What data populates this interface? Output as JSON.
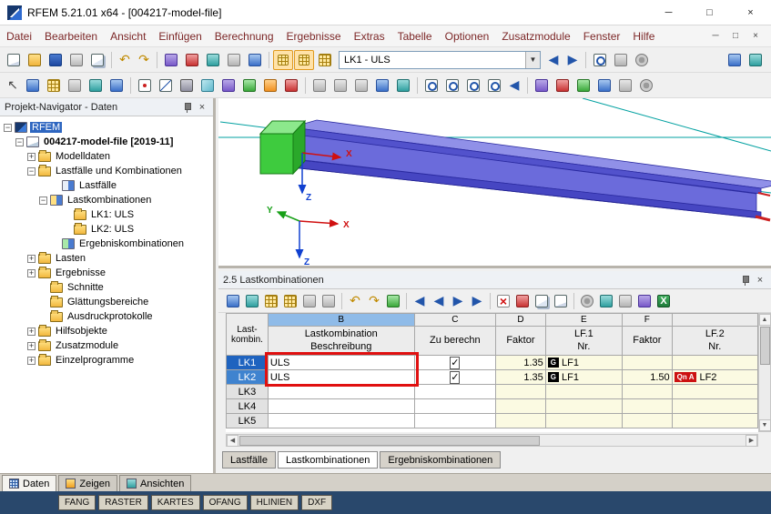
{
  "window": {
    "title": "RFEM 5.21.01 x64 - [004217-model-file]"
  },
  "glyphs": {
    "minimize": "─",
    "maximize": "□",
    "close": "×",
    "dropdown": "▼",
    "undo": "↶",
    "redo": "↷",
    "prev": "◀",
    "next": "▶",
    "check": "✓",
    "plus": "+",
    "minus": "−",
    "up": "▲",
    "down": "▼",
    "left": "◀",
    "right": "▶"
  },
  "menu": {
    "items": [
      "Datei",
      "Bearbeiten",
      "Ansicht",
      "Einfügen",
      "Berechnung",
      "Ergebnisse",
      "Extras",
      "Tabelle",
      "Optionen",
      "Zusatzmodule",
      "Fenster",
      "Hilfe"
    ]
  },
  "toolbar_main": {
    "loadcase_combo": {
      "value": "LK1 - ULS"
    },
    "icon_names": [
      "new-file",
      "open-file",
      "save-file",
      "print",
      "copy",
      "undo",
      "redo",
      "render-mode",
      "show-loads",
      "show-supports",
      "page-setup",
      "link-model",
      "show-tables",
      "show-grid",
      "table-numbers",
      "previous-loadcase",
      "next-loadcase",
      "search",
      "display-factors",
      "settings",
      "panel-toggle",
      "help"
    ]
  },
  "toolbar_secondary": {
    "icon_names": [
      "select",
      "snap",
      "grid-settings",
      "ortho-mode",
      "guidelines",
      "workplane",
      "new-node",
      "new-line",
      "new-member",
      "new-surface",
      "new-solid",
      "new-support",
      "new-hinge",
      "new-load",
      "move-copy",
      "rotate",
      "mirror",
      "visibility",
      "user-view",
      "zoom-window",
      "zoom-in",
      "zoom-out",
      "zoom-all",
      "previous-view",
      "isometric-view",
      "view-x",
      "view-y",
      "view-z",
      "perspective",
      "display-options"
    ]
  },
  "navigator": {
    "title": "Projekt-Navigator - Daten",
    "tree": [
      {
        "label": "RFEM",
        "level": 0,
        "expander": "minus",
        "icon": "rfem",
        "selected": true
      },
      {
        "label": "004217-model-file [2019-11]",
        "level": 1,
        "expander": "minus",
        "icon": "model",
        "bold": true
      },
      {
        "label": "Modelldaten",
        "level": 2,
        "expander": "plus",
        "icon": "folder"
      },
      {
        "label": "Lastfälle und Kombinationen",
        "level": 2,
        "expander": "minus",
        "icon": "folder"
      },
      {
        "label": "Lastfälle",
        "level": 3,
        "expander": "none",
        "icon": "loadcase"
      },
      {
        "label": "Lastkombinationen",
        "level": 3,
        "expander": "minus",
        "icon": "loadcombo"
      },
      {
        "label": "LK1: ULS",
        "level": 4,
        "expander": "none",
        "icon": "folder"
      },
      {
        "label": "LK2: ULS",
        "level": 4,
        "expander": "none",
        "icon": "folder"
      },
      {
        "label": "Ergebniskombinationen",
        "level": 3,
        "expander": "none",
        "icon": "resultcombo"
      },
      {
        "label": "Lasten",
        "level": 2,
        "expander": "plus",
        "icon": "folder"
      },
      {
        "label": "Ergebnisse",
        "level": 2,
        "expander": "plus",
        "icon": "folder"
      },
      {
        "label": "Schnitte",
        "level": 2,
        "expander": "none",
        "icon": "folder"
      },
      {
        "label": "Glättungsbereiche",
        "level": 2,
        "expander": "none",
        "icon": "folder"
      },
      {
        "label": "Ausdruckprotokolle",
        "level": 2,
        "expander": "none",
        "icon": "folder"
      },
      {
        "label": "Hilfsobjekte",
        "level": 2,
        "expander": "plus",
        "icon": "folder"
      },
      {
        "label": "Zusatzmodule",
        "level": 2,
        "expander": "plus",
        "icon": "folder"
      },
      {
        "label": "Einzelprogramme",
        "level": 2,
        "expander": "plus",
        "icon": "folder"
      }
    ],
    "tabs": [
      {
        "label": "Daten",
        "active": true
      },
      {
        "label": "Zeigen",
        "active": false
      },
      {
        "label": "Ansichten",
        "active": false
      }
    ]
  },
  "viewport": {
    "axis_labels": {
      "x": "X",
      "y": "Y",
      "z": "Z"
    }
  },
  "table_panel": {
    "title": "2.5 Lastkombinationen",
    "toolbar_icon_names": [
      "edit-in-graphic",
      "jump-to-graphic",
      "insert-row",
      "delete-row",
      "fill-down",
      "import-table",
      "undo",
      "redo",
      "refresh",
      "first-row",
      "previous-row",
      "next-row",
      "last-row",
      "delete-rows",
      "cut-row",
      "copy-row",
      "paste-row",
      "view-settings",
      "table-filter",
      "calculator",
      "statistics",
      "export-excel"
    ],
    "header": {
      "col_a_line1": "Last-",
      "col_a_line2": "kombin.",
      "letters": [
        "B",
        "C",
        "D",
        "E",
        "F"
      ],
      "b_line1": "Lastkombination",
      "b_line2": "Beschreibung",
      "c": "Zu berechn",
      "lf1": "LF.1",
      "lf2": "LF.2",
      "faktor": "Faktor",
      "nr": "Nr."
    },
    "rows": [
      {
        "id": "LK1",
        "beschreibung": "ULS",
        "zu_berechnen": true,
        "lf1_faktor": "1.35",
        "lf1_typ": "G",
        "lf1_nr": "LF1",
        "lf2_faktor": "",
        "lf2_typ": "",
        "lf2_nr": ""
      },
      {
        "id": "LK2",
        "beschreibung": "ULS",
        "zu_berechnen": true,
        "lf1_faktor": "1.35",
        "lf1_typ": "G",
        "lf1_nr": "LF1",
        "lf2_faktor": "1.50",
        "lf2_typ": "Qn A",
        "lf2_nr": "LF2"
      },
      {
        "id": "LK3",
        "beschreibung": "",
        "zu_berechnen": false,
        "lf1_faktor": "",
        "lf1_typ": "",
        "lf1_nr": "",
        "lf2_faktor": "",
        "lf2_typ": "",
        "lf2_nr": ""
      },
      {
        "id": "LK4",
        "beschreibung": "",
        "zu_berechnen": false,
        "lf1_faktor": "",
        "lf1_typ": "",
        "lf1_nr": "",
        "lf2_faktor": "",
        "lf2_typ": "",
        "lf2_nr": ""
      },
      {
        "id": "LK5",
        "beschreibung": "",
        "zu_berechnen": false,
        "lf1_faktor": "",
        "lf1_typ": "",
        "lf1_nr": "",
        "lf2_faktor": "",
        "lf2_typ": "",
        "lf2_nr": ""
      }
    ],
    "tabs": [
      {
        "label": "Lastfälle",
        "active": false
      },
      {
        "label": "Lastkombinationen",
        "active": true
      },
      {
        "label": "Ergebniskombinationen",
        "active": false
      }
    ]
  },
  "statusbar": {
    "toggles": [
      "FANG",
      "RASTER",
      "KARTES",
      "OFANG",
      "HLINIEN",
      "DXF"
    ]
  },
  "colors": {
    "selection_blue": "#2e66c0",
    "column_header_blue": "#8fbbe8",
    "annotation_red": "#e01010",
    "beam_purple": "#6b6bdb",
    "support_green": "#3ecb3e",
    "guide_teal": "#00a0a0",
    "badge_g_bg": "#000000",
    "badge_q_bg": "#cc1111",
    "statusbar_navy": "#29486c"
  }
}
